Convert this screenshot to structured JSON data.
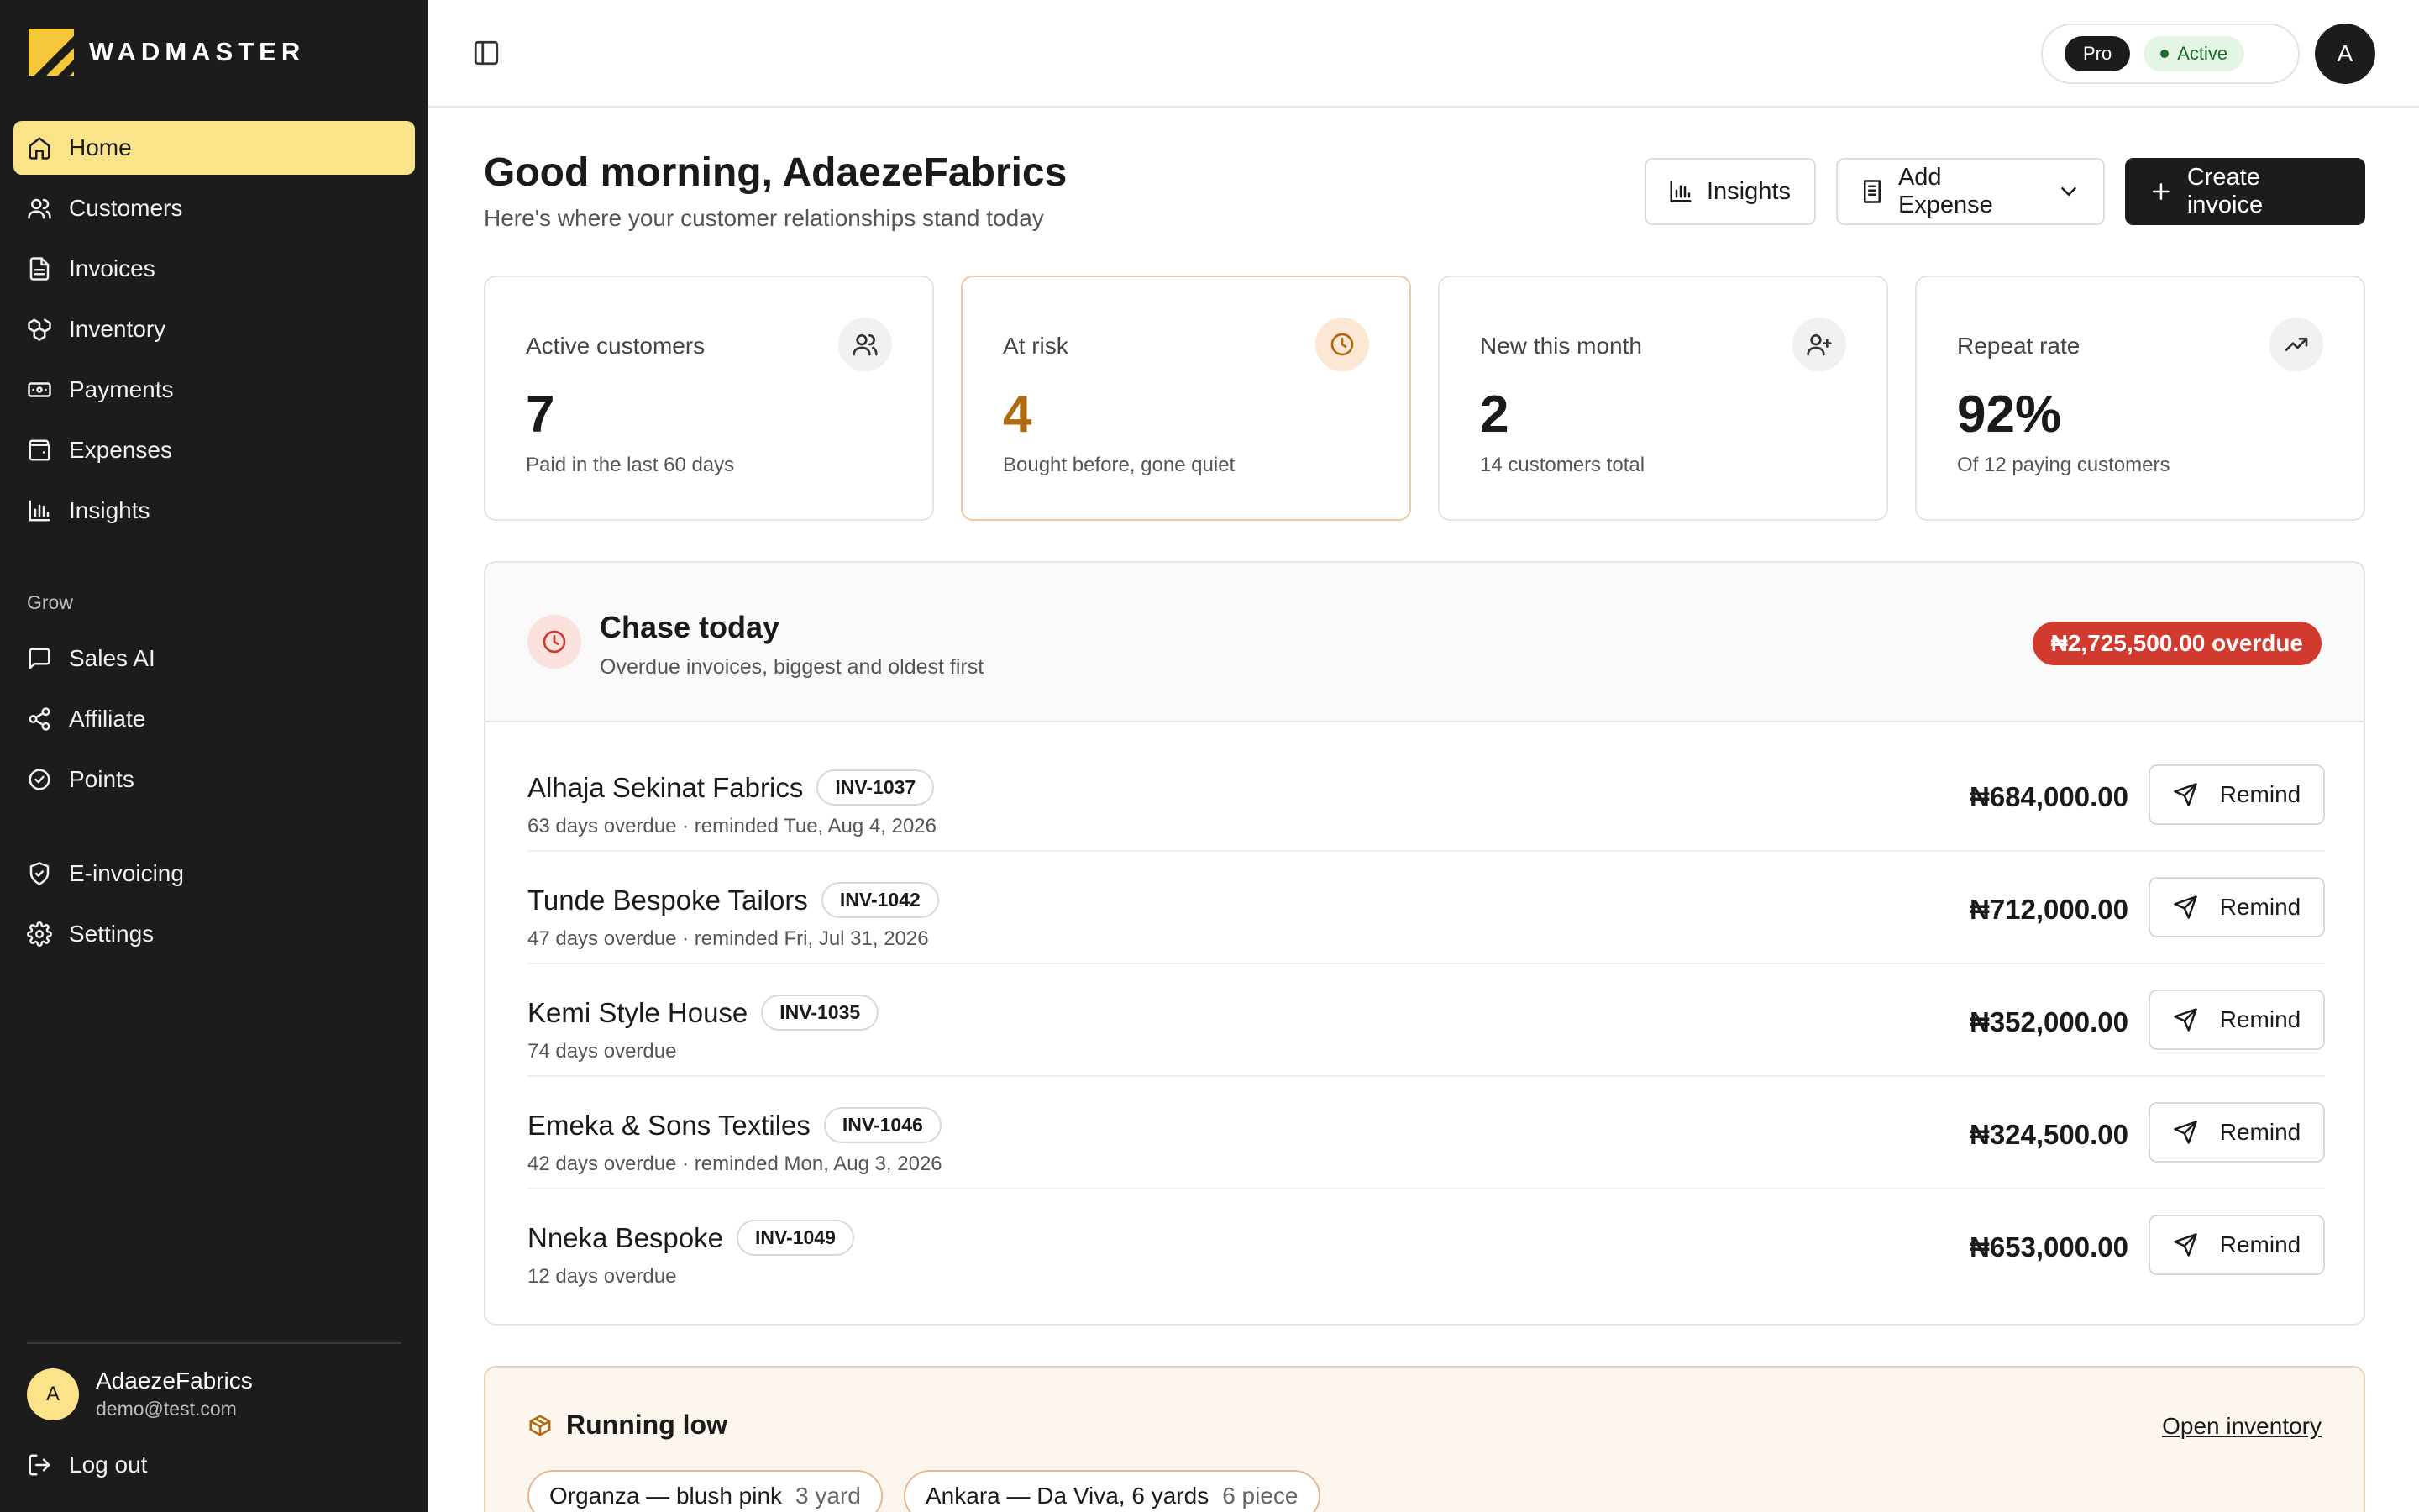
{
  "brand": {
    "name": "WADMASTER",
    "accent": "#fbe38a",
    "logo_color": "#f5c83a"
  },
  "sidebar": {
    "items": [
      {
        "label": "Home",
        "icon": "home-icon",
        "active": true
      },
      {
        "label": "Customers",
        "icon": "users-icon"
      },
      {
        "label": "Invoices",
        "icon": "file-icon"
      },
      {
        "label": "Inventory",
        "icon": "boxes-icon"
      },
      {
        "label": "Payments",
        "icon": "banknote-icon"
      },
      {
        "label": "Expenses",
        "icon": "wallet-icon"
      },
      {
        "label": "Insights",
        "icon": "bar-chart-icon"
      }
    ],
    "grow_label": "Grow",
    "grow_items": [
      {
        "label": "Sales AI",
        "icon": "message-icon"
      },
      {
        "label": "Affiliate",
        "icon": "share-icon"
      },
      {
        "label": "Points",
        "icon": "badge-check-icon"
      }
    ],
    "bottom_items": [
      {
        "label": "E-invoicing",
        "icon": "shield-check-icon"
      },
      {
        "label": "Settings",
        "icon": "gear-icon"
      }
    ],
    "user": {
      "initial": "A",
      "name": "AdaezeFabrics",
      "email": "demo@test.com"
    },
    "logout_label": "Log out"
  },
  "header": {
    "plan": "Pro",
    "status": "Active",
    "avatar_initial": "A"
  },
  "main": {
    "greeting": "Good morning, AdaezeFabrics",
    "subtitle": "Here's where your customer relationships stand today",
    "actions": {
      "insights": "Insights",
      "add_expense": "Add Expense",
      "create_invoice": "Create invoice"
    },
    "stats": [
      {
        "label": "Active customers",
        "value": "7",
        "note": "Paid in the last 60 days",
        "icon": "users-icon"
      },
      {
        "label": "At risk",
        "value": "4",
        "note": "Bought before, gone quiet",
        "icon": "clock-icon"
      },
      {
        "label": "New this month",
        "value": "2",
        "note": "14 customers total",
        "icon": "user-plus-icon"
      },
      {
        "label": "Repeat rate",
        "value": "92%",
        "note": "Of 12 paying customers",
        "icon": "trending-up-icon"
      }
    ],
    "chase": {
      "title": "Chase today",
      "subtitle": "Overdue invoices, biggest and oldest first",
      "overdue_total": "₦2,725,500.00 overdue",
      "remind_label": "Remind",
      "rows": [
        {
          "name": "Alhaja Sekinat Fabrics",
          "invoice": "INV-1037",
          "meta": "63 days overdue · reminded Tue, Aug 4, 2026",
          "amount": "₦684,000.00"
        },
        {
          "name": "Tunde Bespoke Tailors",
          "invoice": "INV-1042",
          "meta": "47 days overdue · reminded Fri, Jul 31, 2026",
          "amount": "₦712,000.00"
        },
        {
          "name": "Kemi Style House",
          "invoice": "INV-1035",
          "meta": "74 days overdue",
          "amount": "₦352,000.00"
        },
        {
          "name": "Emeka & Sons Textiles",
          "invoice": "INV-1046",
          "meta": "42 days overdue · reminded Mon, Aug 3, 2026",
          "amount": "₦324,500.00"
        },
        {
          "name": "Nneka Bespoke",
          "invoice": "INV-1049",
          "meta": "12 days overdue",
          "amount": "₦653,000.00"
        }
      ]
    },
    "running_low": {
      "title": "Running low",
      "link": "Open inventory",
      "items": [
        {
          "name": "Organza — blush pink",
          "qty": "3 yard"
        },
        {
          "name": "Ankara — Da Viva, 6 yards",
          "qty": "6 piece"
        }
      ]
    }
  }
}
